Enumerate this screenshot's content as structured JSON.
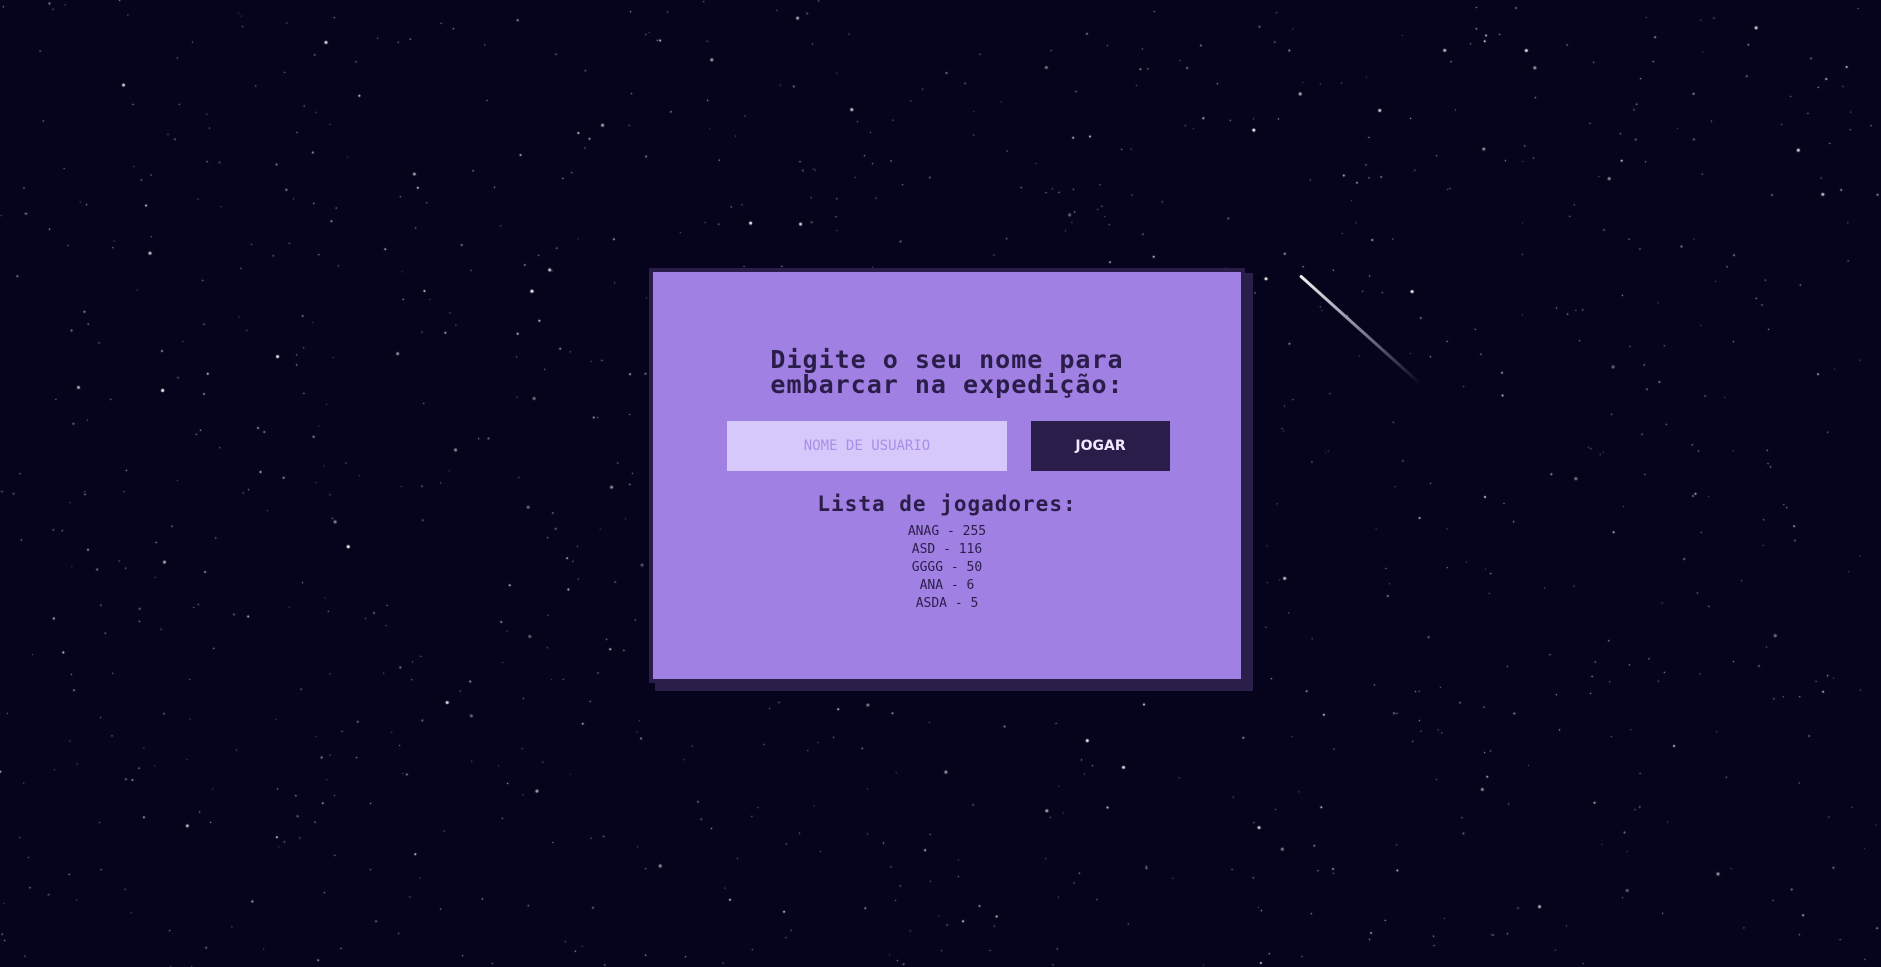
{
  "login": {
    "title_line1": "Digite o seu nome para",
    "title_line2": "embarcar na expedição:",
    "username_placeholder": "NOME DE USUÁRIO",
    "play_label": "JOGAR"
  },
  "players": {
    "heading": "Lista de jogadores:",
    "entries": [
      "ANAG - 255",
      "ASD - 116",
      "GGGG - 50",
      "ANA - 6",
      "ASDA - 5"
    ]
  },
  "colors": {
    "background": "#05041c",
    "panel": "#a081e3",
    "panel_border": "#2b1d4a",
    "input_bg": "#d7c8fc",
    "button_bg": "#2b1d4a"
  },
  "icons": {
    "shooting_star": "shooting-star-icon"
  }
}
